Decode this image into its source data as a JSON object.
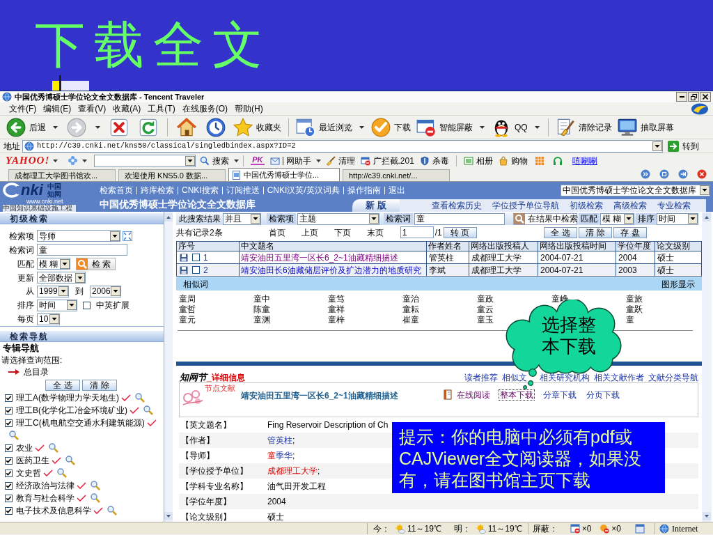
{
  "slide": {
    "title": "下载全文"
  },
  "window": {
    "title": "中国优秀博硕士学位论文全文数据库 - Tencent Traveler"
  },
  "menu": [
    "文件(F)",
    "编辑(E)",
    "查看(V)",
    "收藏(A)",
    "工具(T)",
    "在线服务(O)",
    "帮助(H)"
  ],
  "toolbar": [
    [
      {
        "kind": "back",
        "label": "后退",
        "dropdown": true
      },
      {
        "kind": "forward",
        "dropdown": true
      },
      {
        "kind": "stop",
        "dropdown": false
      },
      {
        "kind": "refresh",
        "dropdown": false
      }
    ],
    [
      {
        "kind": "home",
        "dropdown": false
      },
      {
        "kind": "history",
        "dropdown": false
      },
      {
        "kind": "favorites",
        "label": "收藏夹",
        "dropdown": false
      }
    ],
    [
      {
        "kind": "recent",
        "label": "最近浏览",
        "dropdown": true
      },
      {
        "kind": "download",
        "label": "下载",
        "dropdown": false
      },
      {
        "kind": "block",
        "label": "智能屏蔽",
        "dropdown": true
      },
      {
        "kind": "qq",
        "label": "QQ",
        "dropdown": true
      }
    ],
    [
      {
        "kind": "clear",
        "label": "清除记录",
        "dropdown": false
      },
      {
        "kind": "capture",
        "label": "抽取屏幕",
        "dropdown": false
      }
    ]
  ],
  "address": {
    "label": "地址",
    "url": "http://c39.cnki.net/kns50/classical/singledbindex.aspx?ID=2",
    "go": "转到"
  },
  "yahoo_bar": {
    "logo": "YAHOO!",
    "search_button": "搜索",
    "groups": [
      [
        {
          "kind": "pk",
          "label": "PK",
          "dropdown": false
        },
        {
          "kind": "helper",
          "label": "网助手",
          "dropdown": true
        },
        {
          "kind": "broom",
          "label": "清理",
          "dropdown": false
        },
        {
          "kind": "popup",
          "label": "广拦截.201",
          "dropdown": false
        },
        {
          "kind": "shield",
          "label": "杀毒",
          "dropdown": false
        }
      ],
      [
        {
          "kind": "album",
          "label": "相册",
          "dropdown": false
        },
        {
          "kind": "shopping",
          "label": "购物",
          "dropdown": false
        },
        {
          "kind": "tiles",
          "dropdown": false
        },
        {
          "kind": "headset",
          "dropdown": false
        },
        {
          "kind": "link",
          "label": "嘻唰唰",
          "dropdown": false
        }
      ]
    ]
  },
  "tabs": [
    {
      "label": "成都理工大学图书馆欢...",
      "selected": false
    },
    {
      "label": "欢迎使用 KNS5.0 数据...",
      "selected": false
    },
    {
      "label": "中国优秀博硕士学位...",
      "selected": true
    },
    {
      "label": "http://c39.cnki.net/...",
      "selected": false
    }
  ],
  "site": {
    "logo": {
      "mark": "nki",
      "name": "中国知网",
      "url": "www.cnki.net",
      "tagline": "中国知识基础设施工程"
    },
    "nav": [
      "检索首页",
      "跨库检索",
      "CNKI搜索",
      "订阅推送",
      "CNKI汉英/英汉词典",
      "操作指南",
      "退出"
    ],
    "database": "中国优秀博硕士学位论文全文数据库",
    "title": "中国优秀博硕士学位论文全文数据库",
    "version_tab": "新 版",
    "links": [
      "查看检索历史",
      "学位授予单位导航",
      "初级检索",
      "高级检索",
      "专业检索"
    ]
  },
  "basic_search": {
    "title": "初级检索",
    "field": {
      "label": "检索项",
      "value": "导师"
    },
    "term": {
      "label": "检索词",
      "value": "童"
    },
    "match": {
      "label": "匹配",
      "value": "模 糊",
      "button": "检 索"
    },
    "update": {
      "label": "更新",
      "value": "全部数据"
    },
    "range": {
      "label": "从",
      "from": "1999",
      "to_label": "到",
      "to": "2006"
    },
    "sort": {
      "label": "排序",
      "value": "时间",
      "option": "中英扩展",
      "checked": false
    },
    "per_page": {
      "label": "每页",
      "value": "10"
    }
  },
  "navigation": {
    "title": "检索导航",
    "heading": "专辑导航",
    "prompt": "请选择查询范围:",
    "root": "总目录",
    "buttons": [
      "全 选",
      "清 除"
    ],
    "categories": [
      {
        "label": "理工A(数学物理力学天地生)",
        "checked": true
      },
      {
        "label": "理工B(化学化工冶金环境矿业)",
        "checked": true
      },
      {
        "label": "理工C(机电航空交通水利建筑能源)",
        "checked": true
      },
      {
        "label": "农业",
        "checked": true
      },
      {
        "label": "医药卫生",
        "checked": true
      },
      {
        "label": "文史哲",
        "checked": true
      },
      {
        "label": "经济政治与法律",
        "checked": true
      },
      {
        "label": "教育与社会科学",
        "checked": true
      },
      {
        "label": "电子技术及信息科学",
        "checked": true
      }
    ]
  },
  "results": {
    "filter": {
      "scope_label": "此搜索结果",
      "scope": "并且",
      "field_label": "检索项",
      "field": "主题",
      "term_label": "检索词",
      "term": "童",
      "button": "在结果中检索",
      "match_label": "匹配",
      "match": "模 糊",
      "sort_label": "排序",
      "sort": "时间"
    },
    "pager": {
      "count": "共有记录2条",
      "links": [
        "首页",
        "上页",
        "下页",
        "末页"
      ],
      "page": "1",
      "total": "/1",
      "go": "转 页",
      "actions": [
        "全 选",
        "清 除",
        "存 盘"
      ]
    },
    "table": {
      "columns": [
        "序号",
        "中文题名",
        "作者姓名",
        "网络出版投稿人",
        "网络出版投稿时间",
        "学位年度",
        "论文级别"
      ],
      "rows": [
        {
          "checked": false,
          "visited": true,
          "cells": [
            "1",
            "靖安油田五里湾一区长6_2~1油藏精细描述",
            "管英柱",
            "成都理工大学",
            "2004-07-21",
            "2004",
            "硕士"
          ]
        },
        {
          "checked": false,
          "visited": false,
          "cells": [
            "2",
            "靖安油田长6油藏储层评价及扩边潜力的地质研究",
            "李斌",
            "成都理工大学",
            "2004-07-21",
            "2003",
            "硕士"
          ]
        }
      ]
    },
    "similar": {
      "title": "相似词",
      "graph": "图形显示",
      "columns": [
        [
          "童周",
          "童哲",
          "童元"
        ],
        [
          "童中",
          "陈童",
          "童渊"
        ],
        [
          "童笃",
          "童祥",
          "童梓"
        ],
        [
          "童治",
          "童耘",
          "崔童"
        ],
        [
          "童政",
          "童云",
          "童玉"
        ],
        [
          "童峥"
        ],
        [
          "童旅",
          "童跃",
          "童"
        ]
      ]
    }
  },
  "detail": {
    "logo": "知网节",
    "heading": "_详细信息",
    "links": [
      "读者推荐",
      "相似文",
      "相关研究机构",
      "相关文献作者",
      "文献分类导航"
    ],
    "node_label": "节点文献",
    "title": "靖安油田五里湾一区长6_2~1油藏精细描述",
    "actions": [
      {
        "kind": "read",
        "label": "在线阅读",
        "visited": true,
        "focused": false
      },
      {
        "kind": "link",
        "label": "整本下载",
        "visited": true,
        "focused": true
      },
      {
        "kind": "link",
        "label": "分章下载",
        "visited": false,
        "focused": false
      },
      {
        "kind": "link",
        "label": "分页下载",
        "visited": false,
        "focused": false
      }
    ],
    "fields": [
      {
        "label": "【英文题名】",
        "kind": "text",
        "value": "Fing Reservoir Description of Ch"
      },
      {
        "label": "【作者】",
        "kind": "link",
        "parts": [
          {
            "text": "管英柱",
            "highlight": false
          }
        ],
        "separator": ";"
      },
      {
        "label": "【导师】",
        "kind": "link",
        "parts": [
          {
            "text": "童",
            "highlight": true
          },
          {
            "text": "季华",
            "highlight": false
          }
        ],
        "separator": ";"
      },
      {
        "label": "【学位授予单位】",
        "kind": "link",
        "parts": [
          {
            "text": "成都理工大学",
            "highlight": true
          }
        ],
        "separator": ";"
      },
      {
        "label": "【学科专业名称】",
        "kind": "text",
        "value": "油气田开发工程"
      },
      {
        "label": "【学位年度】",
        "kind": "text",
        "value": "2004"
      },
      {
        "label": "【论文级别】",
        "kind": "text",
        "value": "硕士"
      }
    ]
  },
  "callout": {
    "text": "选择整本下载"
  },
  "note": {
    "text": "提示：你的电脑中必须有pdf或CAJViewer全文阅读器，如果没有，请在图书馆主页下载"
  },
  "status_bar": {
    "weather": [
      {
        "label": "今：",
        "temp": "11～19℃"
      },
      {
        "label": "明：",
        "temp": "11～19℃"
      }
    ],
    "block_label": "屏蔽：",
    "blocked": [
      {
        "kind": "window",
        "count": "×0"
      },
      {
        "kind": "popup",
        "count": "×0"
      }
    ],
    "zone": "Internet"
  }
}
